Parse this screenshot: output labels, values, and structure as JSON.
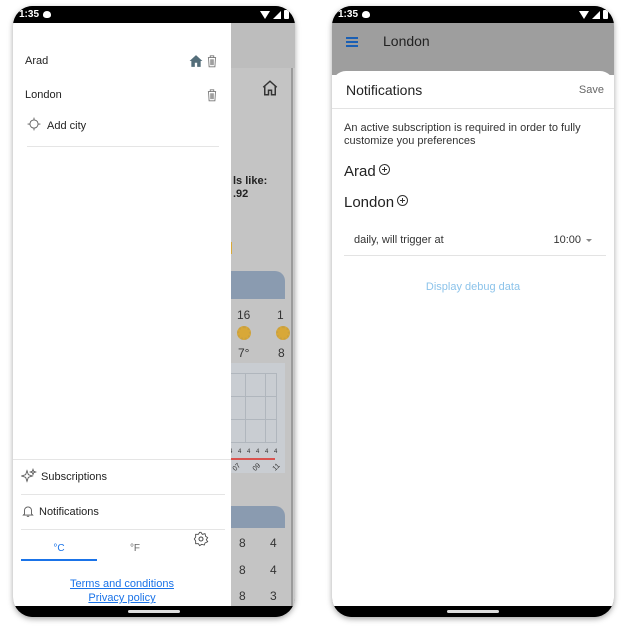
{
  "left_phone": {
    "status_bar": {
      "time": "1:35"
    },
    "background_app": {
      "feels_like_label": "ls like:",
      "feels_like_value": ".92",
      "hourly_top": [
        "16",
        "1"
      ],
      "hourly_temps": [
        "7°",
        "8"
      ],
      "chart_point_labels": [
        "4",
        "4",
        "4",
        "4",
        "4",
        "4"
      ],
      "chart_x_ticks": [
        "07",
        "09",
        "11"
      ],
      "daily_rows": [
        [
          "8",
          "4"
        ],
        [
          "8",
          "4"
        ],
        [
          "8",
          "3"
        ]
      ]
    },
    "drawer": {
      "cities": [
        {
          "name": "Arad",
          "is_home": true
        },
        {
          "name": "London",
          "is_home": false
        }
      ],
      "add_city_label": "Add city",
      "subscriptions_label": "Subscriptions",
      "notifications_label": "Notifications",
      "units": [
        {
          "label": "°C",
          "selected": true
        },
        {
          "label": "°F",
          "selected": false
        }
      ],
      "terms_link": "Terms and conditions",
      "privacy_link": "Privacy policy"
    }
  },
  "right_phone": {
    "status_bar": {
      "time": "1:35"
    },
    "appbar": {
      "title": "London"
    },
    "sheet": {
      "title": "Notifications",
      "save_label": "Save",
      "subscription_notice": "An active subscription is required in order to fully customize you preferences",
      "cities": [
        {
          "name": "Arad"
        },
        {
          "name": "London",
          "schedule_label": "daily, will trigger at",
          "time": "10:00"
        }
      ],
      "debug_link": "Display debug data"
    }
  },
  "colors": {
    "accent": "#1a73e8",
    "debug_link": "#8cc3ea",
    "appbar_dim": "#9e9e9e"
  }
}
